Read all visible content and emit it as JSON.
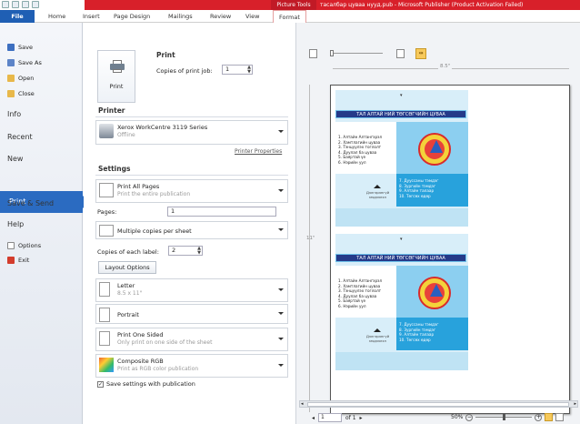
{
  "window": {
    "context_tab": "Picture Tools",
    "title": "тасалбар цуваа нууд.pub - Microsoft Publisher (Product Activation Failed)"
  },
  "ribbon_tabs": [
    "File",
    "Home",
    "Insert",
    "Page Design",
    "Mailings",
    "Review",
    "View",
    "Format"
  ],
  "nav": {
    "save": "Save",
    "save_as": "Save As",
    "open": "Open",
    "close": "Close",
    "info": "Info",
    "recent": "Recent",
    "new": "New",
    "print": "Print",
    "save_send": "Save & Send",
    "help": "Help",
    "options": "Options",
    "exit": "Exit"
  },
  "print_section": {
    "heading": "Print",
    "copies_label": "Copies of print job:",
    "copies_value": "1",
    "print_button": "Print"
  },
  "printer_section": {
    "heading": "Printer",
    "name": "Xerox WorkCentre 3119 Series",
    "status": "Offline",
    "properties_link": "Printer Properties"
  },
  "settings_section": {
    "heading": "Settings",
    "pages_dropdown": {
      "title": "Print All Pages",
      "sub": "Print the entire publication"
    },
    "pages_label": "Pages:",
    "pages_value": "1",
    "layout_dropdown": {
      "title": "Multiple copies per sheet"
    },
    "copies_each_label": "Copies of each label:",
    "copies_each_value": "2",
    "layout_options_button": "Layout Options",
    "paper_dropdown": {
      "title": "Letter",
      "sub": "8.5 x 11\""
    },
    "orientation_dropdown": {
      "title": "Portrait"
    },
    "sides_dropdown": {
      "title": "Print One Sided",
      "sub": "Only print on one side of the sheet"
    },
    "color_dropdown": {
      "title": "Composite RGB",
      "sub": "Print as RGB color publication"
    },
    "save_settings_checkbox": "Save settings with publication",
    "save_settings_checked": true
  },
  "preview": {
    "ruler_label": "8.5\"",
    "vruler_label": "11\"",
    "card": {
      "band_title": "ТАЛ АЛТАЙ НИЙ ТӨГСӨГЧИЙН ЦУВАА",
      "list_left": [
        "1. Алтайн Алтангэрэл",
        "2. Хамтлагийн цуваа",
        "3. Тэнцүүлэх тоглолт",
        "4. Дуулал ба цуваа",
        "5. Баяртай үе",
        "6. Нэрийн уул"
      ],
      "list_right": [
        "7. Дууссаны тэмдэг",
        "8. Зургийн тэмдэг",
        "9. Алтайн талаар",
        "10. Төгсөх өдөр"
      ],
      "small_text": "Дэлгэрэнгүй мэдээлэл"
    },
    "page_current": "1",
    "page_total": "of 1",
    "zoom": "50%"
  }
}
